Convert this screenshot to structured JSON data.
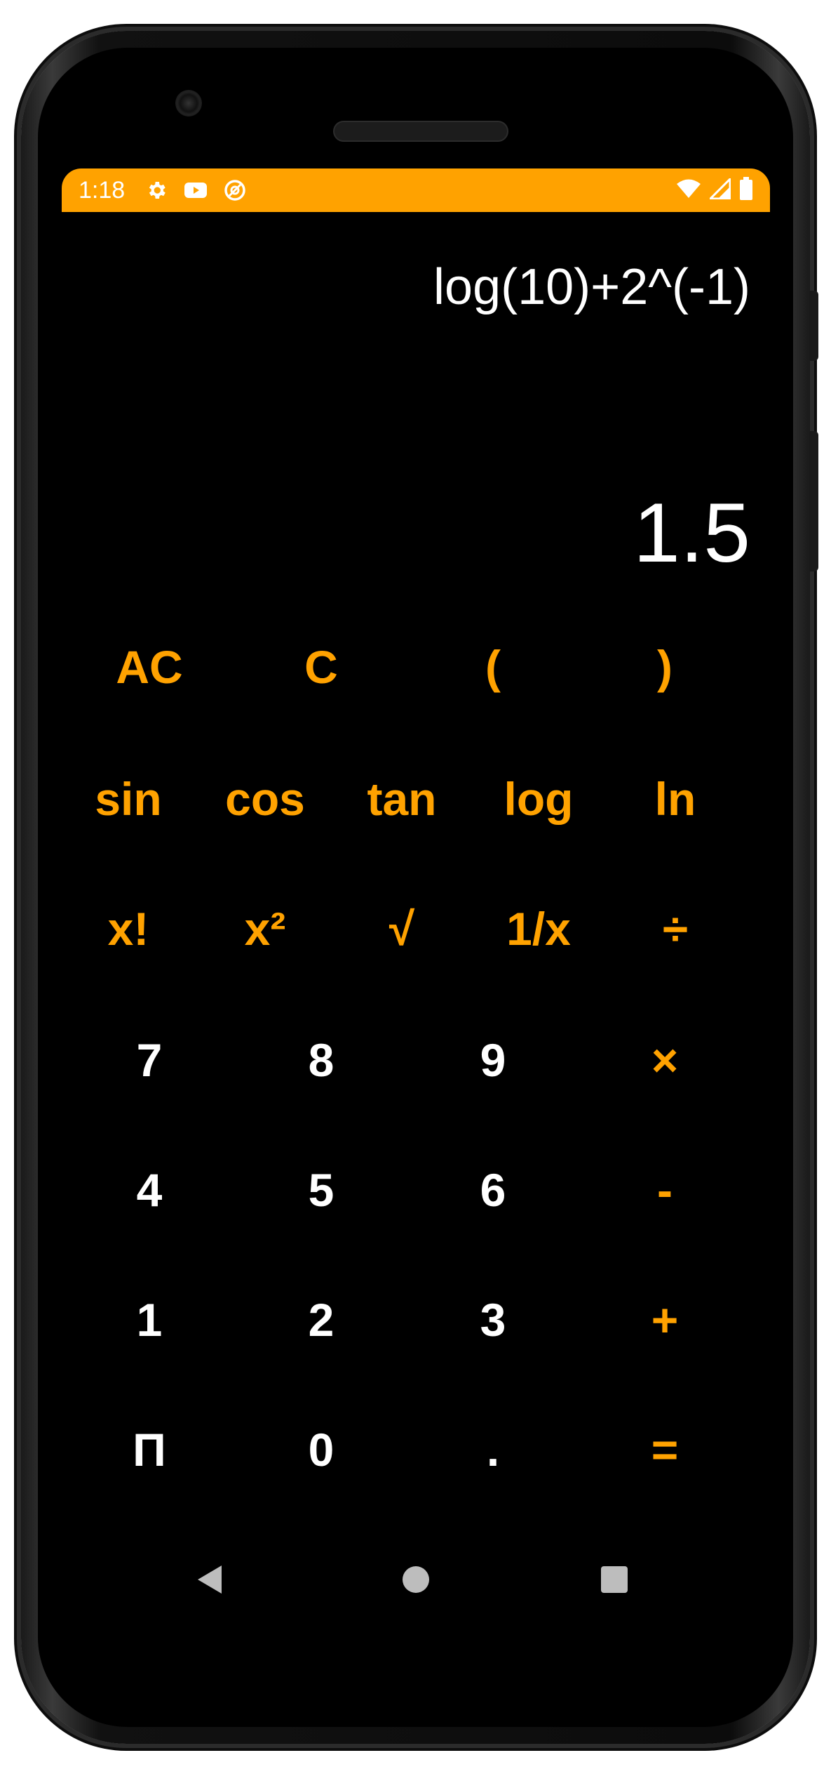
{
  "status_bar": {
    "time": "1:18",
    "background": "#FFA200",
    "left_icons": [
      "settings-gear-icon",
      "youtube-icon",
      "at-sign-icon"
    ],
    "right_icons": [
      "wifi-icon",
      "cellular-signal-icon",
      "battery-icon"
    ]
  },
  "display": {
    "expression": "log(10)+2^(-1)",
    "result": "1.5"
  },
  "keypad": {
    "row1": [
      "AC",
      "C",
      "(",
      ")"
    ],
    "row2": [
      "sin",
      "cos",
      "tan",
      "log",
      "ln"
    ],
    "row3": [
      "x!",
      "x²",
      "√",
      "1/x",
      "÷"
    ],
    "row4": [
      "7",
      "8",
      "9",
      "×"
    ],
    "row5": [
      "4",
      "5",
      "6",
      "-"
    ],
    "row6": [
      "1",
      "2",
      "3",
      "+"
    ],
    "row7": [
      "Π",
      "0",
      ".",
      "="
    ]
  },
  "navigation": {
    "back": "back-triangle-icon",
    "home": "home-circle-icon",
    "recents": "recents-square-icon"
  },
  "colors": {
    "accent": "#FFA200",
    "background": "#000000",
    "digits": "#FFFFFF"
  }
}
